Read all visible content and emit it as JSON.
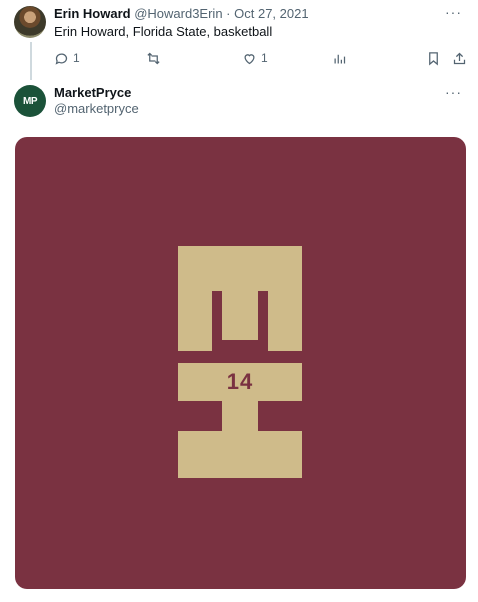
{
  "tweet1": {
    "author_name": "Erin Howard",
    "author_handle": "@Howard3Erin",
    "separator": "·",
    "date": "Oct 27, 2021",
    "more": "···",
    "text": "Erin Howard, Florida State, basketball",
    "reply_count": "1",
    "like_count": "1"
  },
  "tweet2": {
    "avatar_text": "MP",
    "author_name": "MarketPryce",
    "author_handle": "@marketpryce",
    "more": "···",
    "media": {
      "logo_number": "14",
      "colors": {
        "background": "#7a3241",
        "logo": "#cfbb8a"
      }
    }
  },
  "icons": [
    "reply-icon",
    "retweet-icon",
    "like-icon",
    "analytics-icon",
    "bookmark-icon",
    "share-icon"
  ]
}
